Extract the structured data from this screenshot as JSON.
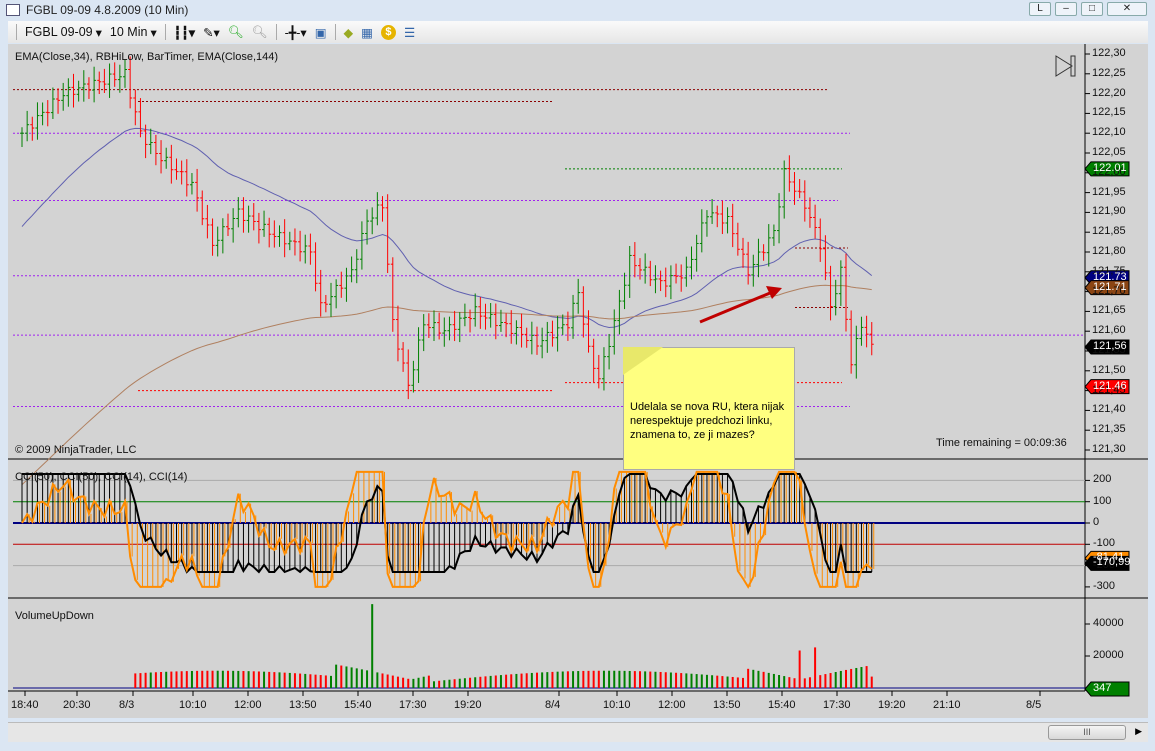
{
  "window": {
    "title": "FGBL 09-09  4.8.2009 (10 Min)",
    "buttons": [
      "L",
      "–",
      "□",
      "✕"
    ]
  },
  "toolbar": {
    "instrument": "FGBL 09-09",
    "interval": "10 Min",
    "icons": [
      "bar-type-icon",
      "drawing-pencil-icon",
      "zoom-in-icon",
      "zoom-out-icon",
      "crosshair-icon",
      "properties-icon",
      "strategy-icon",
      "chart-icon",
      "dollar-icon",
      "data-box-icon"
    ]
  },
  "price_panel": {
    "indicators": "EMA(Close,34), RBHiLow, BarTimer, EMA(Close,144)",
    "copyright": "© 2009 NinjaTrader, LLC",
    "timer": "Time remaining = 00:09:36",
    "ticks": [
      "122,30",
      "122,25",
      "122,20",
      "122,15",
      "122,10",
      "122,05",
      "122,00",
      "121,95",
      "121,90",
      "121,85",
      "121,80",
      "121,75",
      "121,70",
      "121,65",
      "121,60",
      "121,55",
      "121,50",
      "121,45",
      "121,40",
      "121,35",
      "121,30"
    ],
    "markers": [
      {
        "text": "122.01",
        "price": 122.01,
        "color": "#008000"
      },
      {
        "text": "121.73",
        "price": 121.735,
        "color": "#000080"
      },
      {
        "text": "121.71",
        "price": 121.71,
        "color": "#8b4513"
      },
      {
        "text": "121,56",
        "price": 121.56,
        "color": "#000000"
      },
      {
        "text": "121.46",
        "price": 121.46,
        "color": "#ff0000"
      }
    ]
  },
  "cci_panel": {
    "title": "CCI(50), CCI(50), CCI(14), CCI(14)",
    "ticks": [
      "200",
      "100",
      "0",
      "-100",
      "-200",
      "-300"
    ],
    "markers": [
      {
        "text": "-81,41",
        "color": "#ff8c00"
      },
      {
        "text": "-170,99",
        "color": "#000000"
      }
    ]
  },
  "volume_panel": {
    "title": "VolumeUpDown",
    "ticks": [
      "40000",
      "20000"
    ],
    "marker": "347"
  },
  "time_axis": [
    "18:40",
    "20:30",
    "8/3",
    "10:10",
    "12:00",
    "13:50",
    "15:40",
    "17:30",
    "19:20",
    "8/4",
    "10:10",
    "12:00",
    "13:50",
    "15:40",
    "17:30",
    "19:20",
    "21:10",
    "8/5"
  ],
  "note": {
    "text": "Udelala se nova RU, ktera nijak nerespektuje predchozi linku, znamena to, ze ji mazes?"
  },
  "chart_data": {
    "type": "candlestick",
    "price_range": [
      121.3,
      122.3
    ],
    "close_path": [
      [
        0,
        122.1
      ],
      [
        8,
        122.2
      ],
      [
        20,
        122.25
      ],
      [
        23,
        122.1
      ],
      [
        26,
        122.05
      ],
      [
        33,
        121.97
      ],
      [
        37,
        121.82
      ],
      [
        42,
        121.9
      ],
      [
        48,
        121.85
      ],
      [
        56,
        121.8
      ],
      [
        58,
        121.66
      ],
      [
        64,
        121.75
      ],
      [
        67,
        121.88
      ],
      [
        70,
        121.92
      ],
      [
        72,
        121.62
      ],
      [
        75,
        121.46
      ],
      [
        78,
        121.62
      ],
      [
        82,
        121.6
      ],
      [
        88,
        121.65
      ],
      [
        96,
        121.6
      ],
      [
        100,
        121.57
      ],
      [
        106,
        121.62
      ],
      [
        108,
        121.7
      ],
      [
        110,
        121.55
      ],
      [
        112,
        121.48
      ],
      [
        115,
        121.62
      ],
      [
        118,
        121.78
      ],
      [
        124,
        121.72
      ],
      [
        129,
        121.75
      ],
      [
        133,
        121.9
      ],
      [
        137,
        121.88
      ],
      [
        141,
        121.75
      ],
      [
        146,
        121.85
      ],
      [
        148,
        122.0
      ],
      [
        152,
        121.92
      ],
      [
        155,
        121.82
      ],
      [
        157,
        121.66
      ],
      [
        159,
        121.75
      ],
      [
        161,
        121.52
      ],
      [
        163,
        121.62
      ],
      [
        165,
        121.56
      ]
    ],
    "rbhilow_lines": [
      122.21,
      122.18,
      122.1,
      122.01,
      121.93,
      121.81,
      121.74,
      121.66,
      121.59,
      121.47,
      121.46,
      121.41
    ],
    "cci_range": [
      -320,
      240
    ],
    "volume_range": [
      0,
      48000
    ]
  }
}
